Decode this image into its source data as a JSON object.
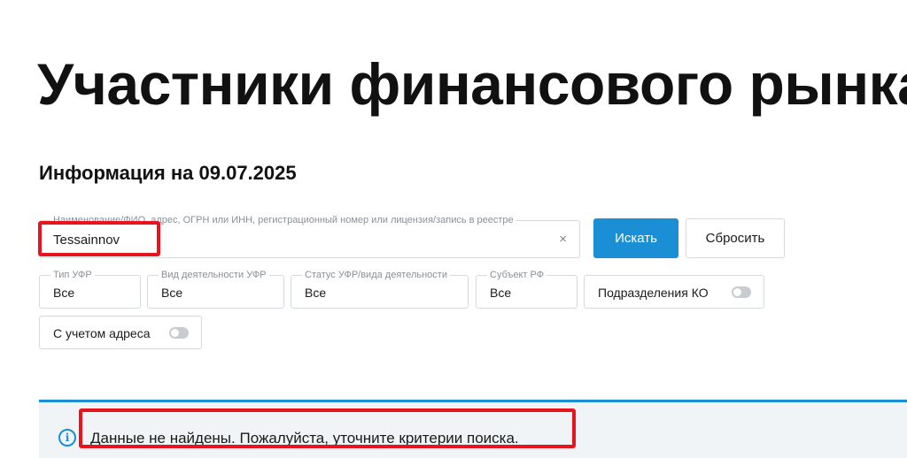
{
  "page": {
    "title": "Участники финансового рынка",
    "info_date": "Информация на 09.07.2025"
  },
  "search": {
    "label": "Наименование/ФИО, адрес, ОГРН или ИНН, регистрационный номер или лицензия/запись в реестре",
    "value": "Tessainnov",
    "clear_glyph": "×"
  },
  "buttons": {
    "search_label": "Искать",
    "reset_label": "Сбросить"
  },
  "filters": [
    {
      "label": "Тип УФР",
      "value": "Все"
    },
    {
      "label": "Вид деятельности УФР",
      "value": "Все"
    },
    {
      "label": "Статус УФР/вида деятельности",
      "value": "Все"
    },
    {
      "label": "Субъект РФ",
      "value": "Все"
    }
  ],
  "toggles": {
    "divisions": {
      "label": "Подразделения КО",
      "on": false
    },
    "address": {
      "label": "С учетом адреса",
      "on": false
    }
  },
  "result": {
    "icon_glyph": "i",
    "message": "Данные не найдены. Пожалуйста, уточните критерии поиска."
  },
  "colors": {
    "accent": "#1a8fd6",
    "highlight": "#e6141e",
    "panel_bg": "#f1f4f7"
  },
  "icons": {
    "clear": "close-icon",
    "info": "info-icon"
  }
}
